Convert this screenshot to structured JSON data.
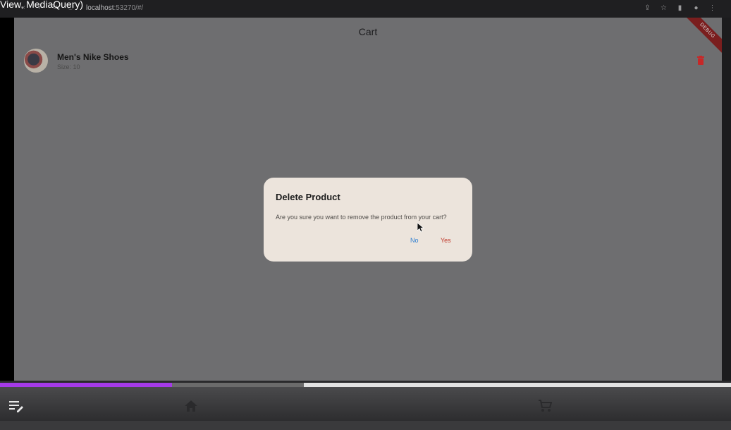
{
  "overlay": {
    "label": "View, MediaQuery)"
  },
  "browser": {
    "url_host": "localhost",
    "url_rest": ":53270/#/",
    "nav_icons": [
      "back-icon",
      "forward-icon",
      "reload-icon",
      "info-icon"
    ],
    "action_icons": [
      "share-icon",
      "star-icon",
      "sidebar-icon",
      "profile-icon",
      "menu-icon"
    ]
  },
  "app": {
    "title": "Cart",
    "debug_banner": "DEBUG"
  },
  "cart": {
    "items": [
      {
        "name": "Men's Nike Shoes",
        "size": "Size: 10"
      }
    ]
  },
  "dialog": {
    "title": "Delete Product",
    "message": "Are you sure you want to remove the product from your cart?",
    "no_label": "No",
    "yes_label": "Yes"
  },
  "progress": {
    "played_fraction": 0.235,
    "buffered_fraction": 0.416
  },
  "bottom_nav": {
    "icons": [
      "edit-list-icon",
      "home-icon",
      "cart-icon"
    ]
  },
  "colors": {
    "accent_no": "#2f7fd1",
    "accent_yes": "#c0392b",
    "trash": "#c62828",
    "progress": "#a53ae8"
  }
}
